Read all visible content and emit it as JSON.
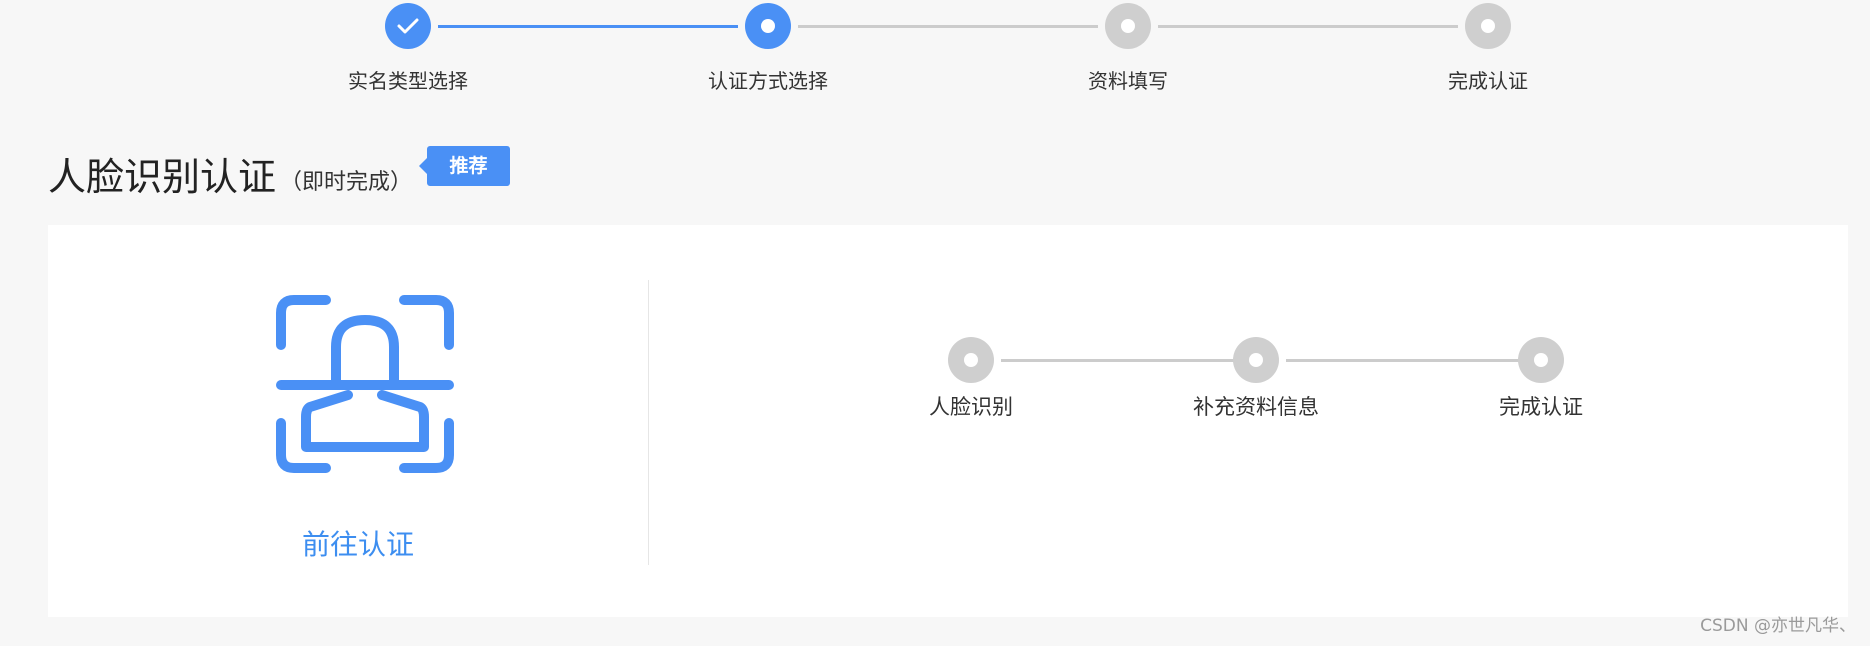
{
  "stepper": {
    "steps": [
      {
        "label": "实名类型选择",
        "state": "done"
      },
      {
        "label": "认证方式选择",
        "state": "current"
      },
      {
        "label": "资料填写",
        "state": "pending"
      },
      {
        "label": "完成认证",
        "state": "pending"
      }
    ]
  },
  "section": {
    "title": "人脸识别认证",
    "subtitle": "（即时完成）",
    "badge": "推荐"
  },
  "card": {
    "icon": "face-recognition-icon",
    "action_label": "前往认证",
    "flow_steps": [
      {
        "label": "人脸识别"
      },
      {
        "label": "补充资料信息"
      },
      {
        "label": "完成认证"
      }
    ]
  },
  "watermark": "CSDN @亦世凡华、",
  "colors": {
    "accent": "#4a90f5",
    "inactive": "#cfcfcf",
    "link": "#3d8ef0",
    "background": "#f7f7f7",
    "card": "#ffffff"
  }
}
